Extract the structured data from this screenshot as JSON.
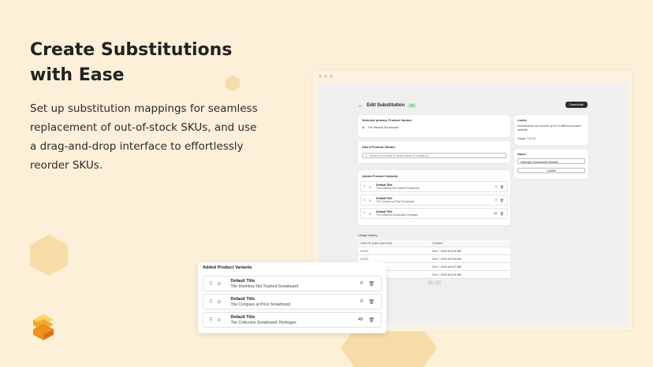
{
  "marketing": {
    "headline_line1": "Create Substitutions",
    "headline_line2": "with Ease",
    "body": "Set up substitution mappings for seamless replacement of out-of-stock SKUs, and use a drag-and-drop interface to effortlessly reorder SKUs."
  },
  "colors": {
    "background": "#fdf0d8",
    "hexagon": "#f8dca8",
    "logo_primary": "#f2a724"
  },
  "app": {
    "title": "Edit Substitution",
    "status_badge": "On",
    "top_button": "Deactivate",
    "primary_card": {
      "heading": "Selected primary Product Variant",
      "product": "The Minimal Snowboard"
    },
    "add_card": {
      "heading": "Add a Product Variant",
      "search_placeholder": "Search by Product & Variant name or Shopify ID"
    },
    "added_card": {
      "heading": "Added Product Variants",
      "rows": [
        {
          "title": "Default Title",
          "product": "The Inventory Not Tracked Snowboard",
          "qty": "0"
        },
        {
          "title": "Default Title",
          "product": "The Compare at Price Snowboard",
          "qty": "0"
        },
        {
          "title": "Default Title",
          "product": "The Collection Snowboard: Hydrogen",
          "qty": "49"
        }
      ]
    },
    "limits_card": {
      "heading": "Limits",
      "text": "Substitutions can include up to 10 different product variants.",
      "usage": "Usage: 3 of 10"
    },
    "name_card": {
      "heading": "Name",
      "value": "Hydrogen Snowboard Variants",
      "button": "Update"
    },
    "usage_history": {
      "heading": "Usage history",
      "col1": "Order ID (click order link)",
      "col2": "Created",
      "rows": [
        {
          "order": "#1044",
          "created": "Oct 7, 2024 at 5:41 AM"
        },
        {
          "order": "#1043",
          "created": "Oct 7, 2024 at 5:34 AM"
        },
        {
          "order": "",
          "created": "Oct 7, 2024 at 5:27 AM"
        },
        {
          "order": "",
          "created": "Oct 7, 2024 at 5:21 AM"
        }
      ]
    }
  },
  "foreground": {
    "heading": "Added Product Variants",
    "rows": [
      {
        "title": "Default Title",
        "product": "The Inventory Not Tracked Snowboard",
        "qty": "0"
      },
      {
        "title": "Default Title",
        "product": "The Compare at Price Snowboard",
        "qty": "0"
      },
      {
        "title": "Default Title",
        "product": "The Collection Snowboard: Hydrogen",
        "qty": "49"
      }
    ]
  }
}
